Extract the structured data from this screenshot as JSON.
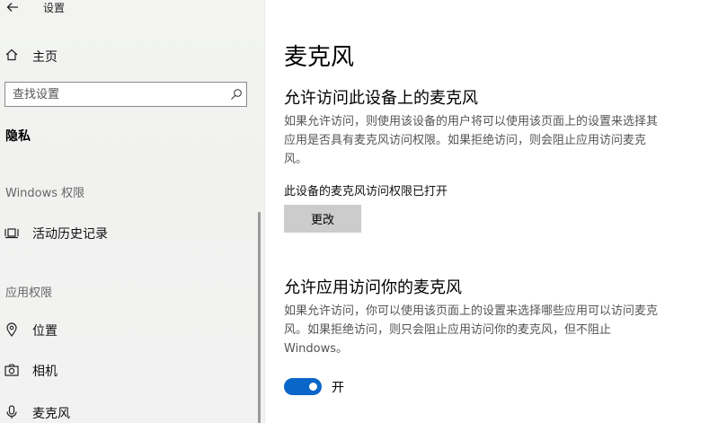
{
  "window": {
    "title": "设置",
    "back_icon": "back-arrow-icon"
  },
  "sidebar": {
    "home": {
      "label": "主页",
      "icon": "home-icon"
    },
    "search": {
      "placeholder": "查找设置",
      "value": "",
      "icon": "search-icon"
    },
    "section_title": "隐私",
    "groups": [
      {
        "header": "Windows 权限",
        "items": [
          {
            "label": "活动历史记录",
            "icon": "activity-history-icon"
          }
        ]
      },
      {
        "header": "应用权限",
        "items": [
          {
            "label": "位置",
            "icon": "location-icon"
          },
          {
            "label": "相机",
            "icon": "camera-icon"
          },
          {
            "label": "麦克风",
            "icon": "microphone-icon"
          }
        ]
      }
    ]
  },
  "main": {
    "title": "麦克风",
    "device_section": {
      "heading": "允许访问此设备上的麦克风",
      "description": "如果允许访问，则使用该设备的用户将可以使用该页面上的设置来选择其应用是否具有麦克风访问权限。如果拒绝访问，则会阻止应用访问麦克风。",
      "status": "此设备的麦克风访问权限已打开",
      "change_button": "更改"
    },
    "apps_section": {
      "heading": "允许应用访问你的麦克风",
      "description": "如果允许访问，你可以使用该页面上的设置来选择哪些应用可以访问麦克风。如果拒绝访问，则只会阻止应用访问你的麦克风，但不阻止 Windows。",
      "toggle_state": true,
      "toggle_label": "开"
    }
  },
  "colors": {
    "accent": "#0a66c8",
    "button_bg": "#cccccc",
    "sidebar_bg": "#f2f2f2",
    "secondary_text": "#555555"
  }
}
